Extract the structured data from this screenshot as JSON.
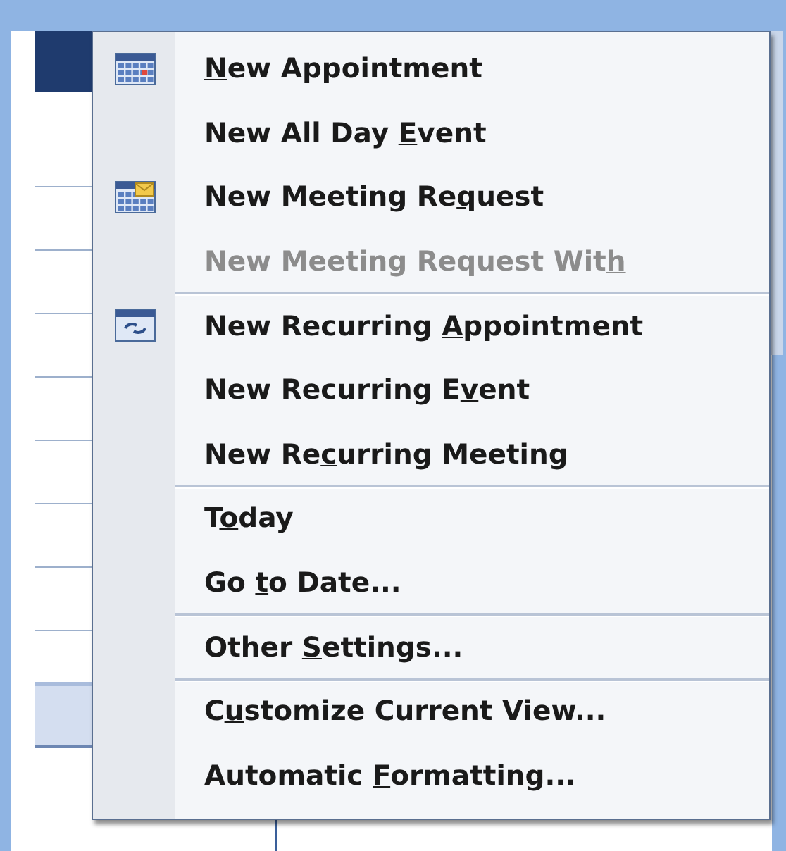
{
  "context_menu": {
    "groups": [
      {
        "items": [
          {
            "kind": "calendar",
            "key": "N",
            "post": "ew Appointment",
            "disabled": false
          },
          {
            "kind": "text",
            "pre": "New All Day ",
            "key": "E",
            "post": "vent",
            "disabled": false
          },
          {
            "kind": "meeting",
            "pre": "New Meeting Re",
            "key": "q",
            "post": "uest",
            "disabled": false
          },
          {
            "kind": "text",
            "pre": "New Meeting Request Wit",
            "key": "h",
            "disabled": true
          }
        ]
      },
      {
        "items": [
          {
            "kind": "recurring",
            "pre": "New Recurring ",
            "key": "A",
            "post": "ppointment",
            "disabled": false
          },
          {
            "kind": "text",
            "pre": "New Recurring E",
            "key": "v",
            "post": "ent",
            "disabled": false
          },
          {
            "kind": "text",
            "pre": "New Re",
            "key": "c",
            "post": "urring Meeting",
            "disabled": false
          }
        ]
      },
      {
        "items": [
          {
            "kind": "text",
            "pre": "T",
            "key": "o",
            "post": "day",
            "disabled": false
          },
          {
            "kind": "text",
            "pre": "Go ",
            "key": "t",
            "post": "o Date...",
            "disabled": false
          }
        ]
      },
      {
        "items": [
          {
            "kind": "text",
            "pre": "Other ",
            "key": "S",
            "post": "ettings...",
            "disabled": false
          }
        ]
      },
      {
        "items": [
          {
            "kind": "text",
            "pre": "C",
            "key": "u",
            "post": "stomize Current View...",
            "disabled": false
          },
          {
            "kind": "text",
            "pre": "Automatic ",
            "key": "F",
            "post": "ormatting...",
            "disabled": false
          }
        ]
      }
    ]
  }
}
